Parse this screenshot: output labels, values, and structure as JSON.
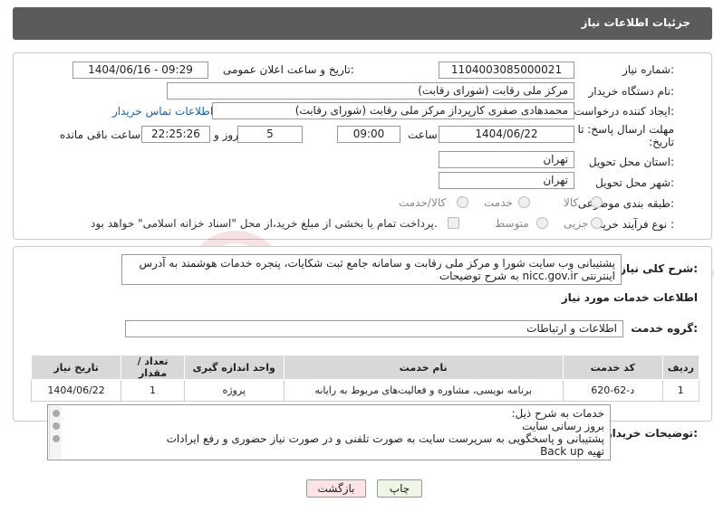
{
  "header": {
    "title": "جزئیات اطلاعات نیاز"
  },
  "need_number": {
    "label": "شماره نیاز:",
    "value": "1104003085000021"
  },
  "announce_datetime": {
    "label": "تاریخ و ساعت اعلان عمومی:",
    "value": "1404/06/16 - 09:29"
  },
  "buyer_org": {
    "label": "نام دستگاه خریدار:",
    "value": "مرکز ملی رقابت (شورای رقابت)"
  },
  "requester": {
    "label": "ایجاد کننده درخواست:",
    "value": "محمدهادی صفری کارپرداز مرکز ملی رقابت (شورای رقابت)",
    "contact_link": "اطلاعات تماس خریدار"
  },
  "deadline": {
    "label": "مهلت ارسال پاسخ: تا تاریخ:",
    "date": "1404/06/22",
    "time_label": "ساعت",
    "time": "09:00",
    "days": "5",
    "days_label": "روز و",
    "remaining": "22:25:26",
    "remaining_label": "ساعت باقی مانده"
  },
  "province": {
    "label": "استان محل تحویل:",
    "value": "تهران"
  },
  "city": {
    "label": "شهر محل تحویل:",
    "value": "تهران"
  },
  "category": {
    "label": "طبقه بندی موضوعی:",
    "options": [
      "کالا",
      "خدمت",
      "کالا/خدمت"
    ]
  },
  "purchase_type": {
    "label": "نوع فرآیند خرید :",
    "options": [
      "جزیی",
      "متوسط"
    ],
    "note": "پرداخت تمام یا بخشی از مبلغ خرید،از محل \"اسناد خزانه اسلامی\" خواهد بود."
  },
  "description": {
    "label": "شرح کلی نیاز:",
    "text": "پشتیبانی وب سایت شورا و مرکز ملی رقابت و سامانه جامع ثبت شکایات، پنجره خدمات هوشمند به آدرس اینترنتی nicc.gov.ir به شرح توضیحات"
  },
  "services_section": {
    "title": "اطلاعات خدمات مورد نیاز"
  },
  "service_group": {
    "label": "گروه خدمت:",
    "value": "اطلاعات و ارتباطات"
  },
  "table": {
    "headers": [
      "ردیف",
      "کد خدمت",
      "نام خدمت",
      "واحد اندازه گیری",
      "تعداد / مقدار",
      "تاریخ نیاز"
    ],
    "rows": [
      [
        "1",
        "د-62-620",
        "برنامه نویسی، مشاوره و فعالیت‌های مربوط به رایانه",
        "پروژه",
        "1",
        "1404/06/22"
      ]
    ]
  },
  "buyer_notes": {
    "label": "توضیحات خریدار:",
    "lines": [
      "خدمات به شرح ذیل:",
      "بروز رسانی سایت",
      "پشتیبانی و پاسخگویی به سرپرست سایت به صورت تلفنی و در صورت نیاز حضوری و رفع ایرادات",
      "تهیه Back up"
    ]
  },
  "buttons": {
    "print": "چاپ",
    "back": "بازگشت"
  },
  "watermark": {
    "text": "AriaTender.neT"
  },
  "colors": {
    "header_bg": "#5b5b5b",
    "link": "#1a5fb4",
    "back_button": "#fde5e5",
    "print_button": "#eef7e6"
  }
}
